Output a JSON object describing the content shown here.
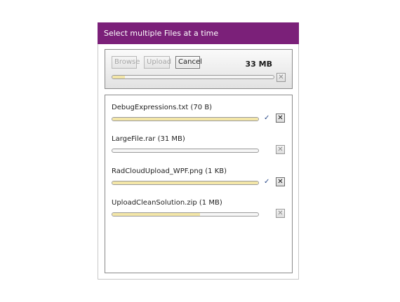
{
  "window": {
    "title": "Select multiple Files at a time"
  },
  "toolbar": {
    "browse_label": "Browse",
    "upload_label": "Upload",
    "cancel_label": "Cancel",
    "total_size": "33 MB",
    "total_progress": 0.08,
    "remove_all_icon": "close-icon"
  },
  "files": [
    {
      "name": "DebugExpressions.txt",
      "size": "(70 B)",
      "progress": 1.0,
      "completed": true
    },
    {
      "name": "LargeFile.rar",
      "size": "(31 MB)",
      "progress": 0.0,
      "completed": false
    },
    {
      "name": "RadCloudUpload_WPF.png",
      "size": "(1 KB)",
      "progress": 1.0,
      "completed": true
    },
    {
      "name": "UploadCleanSolution.zip",
      "size": "(1 MB)",
      "progress": 0.6,
      "completed": false
    }
  ],
  "colors": {
    "titlebar": "#7b2079",
    "progress_fill": "#f3e6a8",
    "check": "#2a4a8a"
  }
}
